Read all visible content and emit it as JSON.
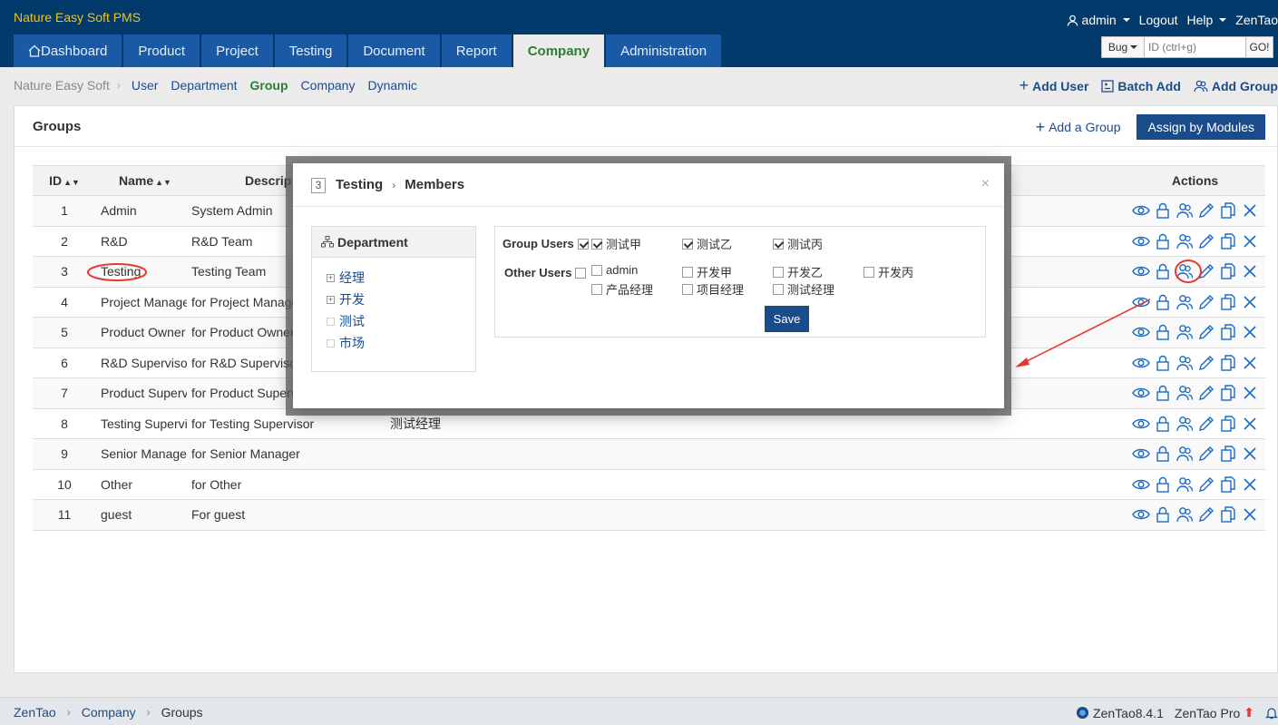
{
  "header": {
    "brand": "Nature Easy Soft PMS",
    "user": "admin",
    "logout": "Logout",
    "help": "Help",
    "zentao": "ZenTao",
    "nav": [
      "Dashboard",
      "Product",
      "Project",
      "Testing",
      "Document",
      "Report",
      "Company",
      "Administration"
    ],
    "active_nav": "Company",
    "search": {
      "type": "Bug",
      "placeholder": "ID (ctrl+g)",
      "go": "GO!"
    }
  },
  "subnav": {
    "crumb": "Nature Easy Soft",
    "items": [
      "User",
      "Department",
      "Group",
      "Company",
      "Dynamic"
    ],
    "active": "Group",
    "actions": {
      "add_user": "Add User",
      "batch_add": "Batch Add",
      "add_group": "Add Group"
    }
  },
  "panel": {
    "title": "Groups",
    "add_group": "Add a Group",
    "assign": "Assign by Modules",
    "columns": {
      "id": "ID",
      "name": "Name",
      "desc": "Descrip",
      "actions": "Actions"
    },
    "rows": [
      {
        "id": "1",
        "name": "Admin",
        "desc": "System Admin",
        "users": ""
      },
      {
        "id": "2",
        "name": "R&D",
        "desc": "R&D Team",
        "users": ""
      },
      {
        "id": "3",
        "name": "Testing",
        "desc": "Testing Team",
        "users": ""
      },
      {
        "id": "4",
        "name": "Project Manager",
        "desc": "for Project Manager",
        "users": ""
      },
      {
        "id": "5",
        "name": "Product Owner",
        "desc": "for Product Owner",
        "users": ""
      },
      {
        "id": "6",
        "name": "R&D Supervisor",
        "desc": "for R&D Supervisor",
        "users": ""
      },
      {
        "id": "7",
        "name": "Product Supervisor",
        "desc": "for Product Supervisor",
        "users": ""
      },
      {
        "id": "8",
        "name": "Testing Supervisor",
        "desc": "for Testing Supervisor",
        "users": "测试经理"
      },
      {
        "id": "9",
        "name": "Senior Manager",
        "desc": "for Senior Manager",
        "users": ""
      },
      {
        "id": "10",
        "name": "Other",
        "desc": "for Other",
        "users": ""
      },
      {
        "id": "11",
        "name": "guest",
        "desc": "For guest",
        "users": ""
      }
    ]
  },
  "modal": {
    "group_id": "3",
    "group_name": "Testing",
    "section": "Members",
    "close": "×",
    "dept_title": "Department",
    "depts": [
      "经理",
      "开发",
      "测试",
      "市场"
    ],
    "group_users_label": "Group Users",
    "other_users_label": "Other Users",
    "group_users": [
      "测试甲",
      "测试乙",
      "测试丙"
    ],
    "other_users": [
      "admin",
      "开发甲",
      "开发乙",
      "开发丙",
      "产品经理",
      "项目经理",
      "测试经理"
    ],
    "save": "Save"
  },
  "footer": {
    "crumbs": [
      "ZenTao",
      "Company",
      "Groups"
    ],
    "version": "ZenTao8.4.1",
    "pro": "ZenTao Pro"
  },
  "colors": {
    "header_bg": "#033a6c",
    "primary": "#1a4c8c",
    "active_green": "#2e7d32",
    "brand": "#f1c40f",
    "annotation": "#e53935"
  }
}
